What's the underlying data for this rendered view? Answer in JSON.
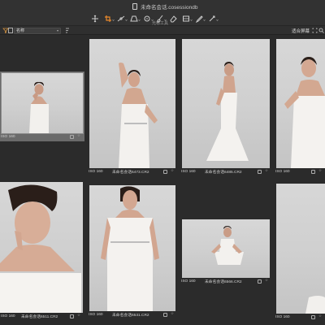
{
  "window": {
    "title": "未命名会话.cosessiondb"
  },
  "toolbar": {
    "tools": [
      "pan-tool",
      "crop-tool",
      "straighten-tool",
      "keystone-tool",
      "spot-removal-tool",
      "brush-tool",
      "eraser-tool",
      "gradient-tool",
      "picker-tool",
      "annotate-tool"
    ],
    "active_tool": "crop-tool",
    "label": "光标工具"
  },
  "filterbar": {
    "sort_value": "名称",
    "fit_label": "适合屏幕"
  },
  "colors": {
    "accent": "#e8892c",
    "background": "#2b2b2b",
    "selected_tile": "#6a6a6a"
  },
  "thumbnails": [
    {
      "iso": "ISO 160",
      "filename": "",
      "selected": true,
      "pose": "hand-chin"
    },
    {
      "iso": "ISO 160",
      "filename": "未命名会话6473.CR2",
      "selected": false,
      "pose": "arm-up"
    },
    {
      "iso": "ISO 160",
      "filename": "未命名会话6485.CR2",
      "selected": false,
      "pose": "back-view"
    },
    {
      "iso": "ISO 160",
      "filename": "",
      "selected": false,
      "pose": "hand-shoulder"
    },
    {
      "iso": "ISO 160",
      "filename": "未命名会话6511.CR2",
      "selected": false,
      "pose": "closeup-lip"
    },
    {
      "iso": "ISO 160",
      "filename": "未命名会话6531.CR2",
      "selected": false,
      "pose": "standing"
    },
    {
      "iso": "ISO 160",
      "filename": "未命名会话6566.CR2",
      "selected": false,
      "pose": "seated"
    },
    {
      "iso": "ISO 160",
      "filename": "",
      "selected": false,
      "pose": "partial"
    }
  ]
}
